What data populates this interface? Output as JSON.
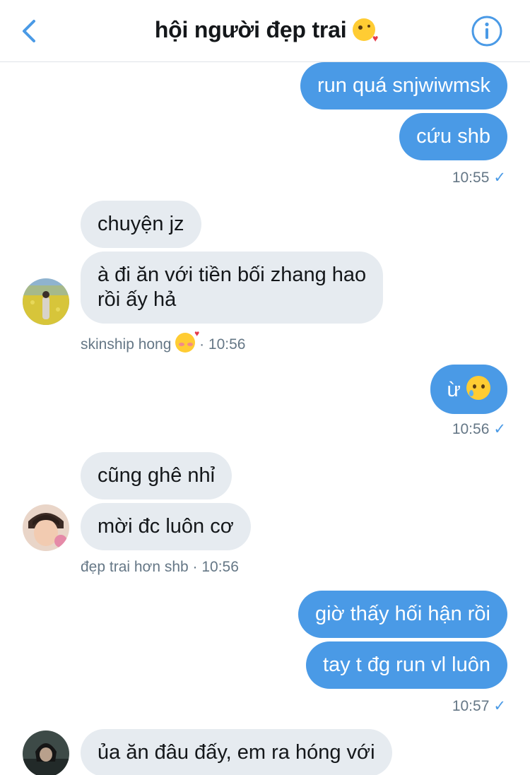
{
  "header": {
    "title": "hội người đẹp trai",
    "title_emoji": "face-blowing-a-kiss",
    "back_icon": "chevron-left-icon",
    "info_icon": "info-circle-icon"
  },
  "colors": {
    "accent": "#4a9ae6",
    "incoming_bubble": "#e6ebf0",
    "meta_text": "#657786"
  },
  "messages": [
    {
      "id": "m1",
      "direction": "out",
      "text": "run quá snjwiwmsk"
    },
    {
      "id": "m2",
      "direction": "out",
      "text": "cứu shb"
    },
    {
      "id": "m3",
      "direction": "in",
      "text": "chuyện jz"
    },
    {
      "id": "m4",
      "direction": "in",
      "line1": "à đi ăn với tiền bối zhang hao",
      "line2": "rồi ấy hả"
    },
    {
      "id": "m5",
      "direction": "out",
      "text": "ừ",
      "emoji": "face-holding-back-tears"
    },
    {
      "id": "m6",
      "direction": "in",
      "text": "cũng ghê nhỉ"
    },
    {
      "id": "m7",
      "direction": "in",
      "text": "mời đc luôn cơ"
    },
    {
      "id": "m8",
      "direction": "out",
      "text": "giờ thấy hối hận rồi"
    },
    {
      "id": "m9",
      "direction": "out",
      "text": "tay t đg run vl luôn"
    },
    {
      "id": "m10",
      "direction": "in",
      "text": "ủa ăn đâu đấy, em ra hóng với"
    }
  ],
  "meta": {
    "g1_time": "10:55",
    "g2_sender": "skinship hong",
    "g2_emoji": "smiling-face-with-hearts",
    "g2_time": "· 10:56",
    "g3_time": "10:56",
    "g4_label": "đẹp trai hơn shb · 10:56",
    "g5_time": "10:57",
    "check_mark": "✓"
  }
}
